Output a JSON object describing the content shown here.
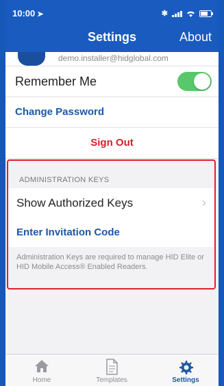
{
  "status_bar": {
    "time": "10:00",
    "location_icon": "location-arrow-icon",
    "bluetooth": "✱"
  },
  "nav": {
    "title": "Settings",
    "right_action": "About"
  },
  "account": {
    "email": "demo.installer@hidglobal.com"
  },
  "settings": {
    "remember_me": {
      "label": "Remember Me",
      "enabled": true
    },
    "change_password": "Change Password",
    "sign_out": "Sign Out"
  },
  "admin_section": {
    "header": "ADMINISTRATION KEYS",
    "show_keys": "Show Authorized Keys",
    "enter_code": "Enter Invitation Code",
    "note": "Administration Keys are required to manage HID Elite or HID Mobile Access® Enabled Readers."
  },
  "tabs": [
    {
      "label": "Home",
      "icon": "house-icon"
    },
    {
      "label": "Templates",
      "icon": "document-icon"
    },
    {
      "label": "Settings",
      "icon": "gear-icon",
      "active": true
    }
  ],
  "colors": {
    "brand": "#1a5bc0",
    "link": "#1b57a8",
    "danger": "#d91c2b",
    "toggle_on": "#58c86a",
    "highlight": "#e0202a"
  }
}
